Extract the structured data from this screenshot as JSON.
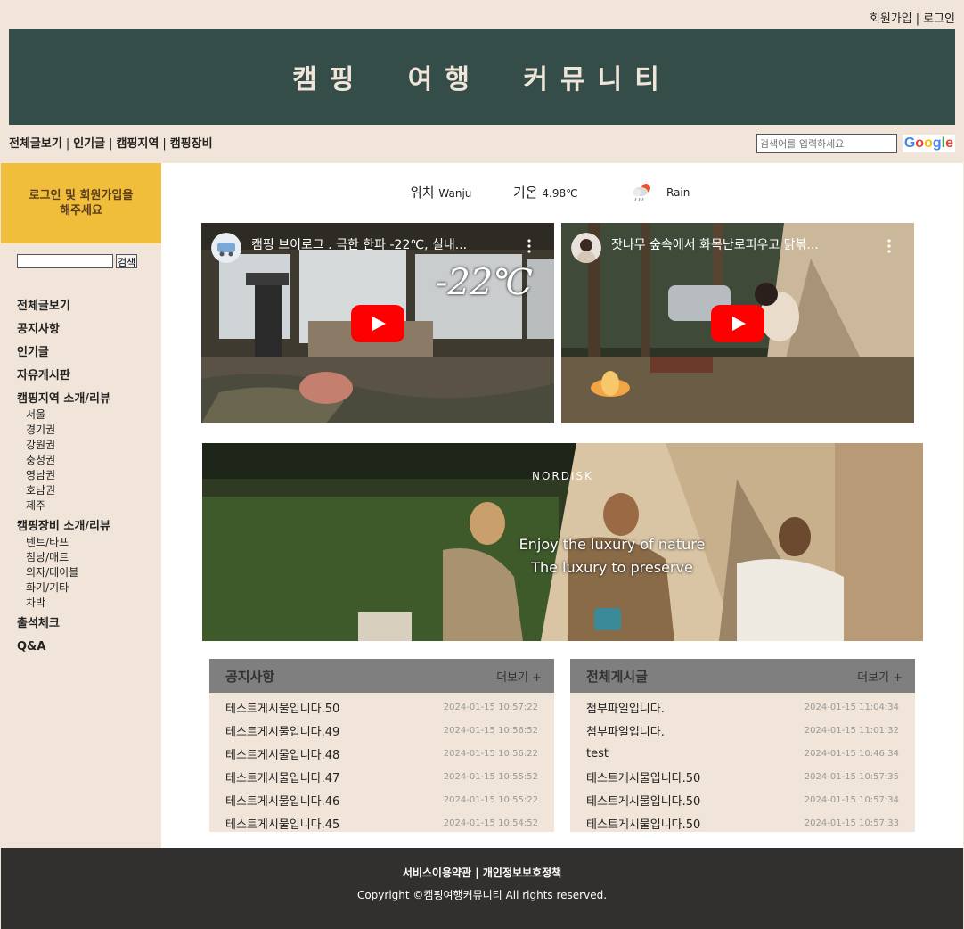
{
  "topbar": {
    "signup": "회원가입",
    "login": "로그인",
    "sep": "|"
  },
  "banner": {
    "title": "캠핑 여행 커뮤니티"
  },
  "mainnav": {
    "items": [
      "전체글보기",
      "인기글",
      "캠핑지역",
      "캠핑장비"
    ],
    "sep": "|"
  },
  "search": {
    "placeholder": "검색어를 입력하세요",
    "logo": [
      "G",
      "o",
      "o",
      "g",
      "l",
      "e"
    ]
  },
  "sidebar": {
    "login_msg_line1": "로그인 및 회원가입을",
    "login_msg_line2": "해주세요",
    "search_button": "검색",
    "menu": {
      "all": "전체글보기",
      "notice": "공지사항",
      "popular": "인기글",
      "free": "자유게시판",
      "region": "캠핑지역 소개/리뷰",
      "region_sub": [
        "서울",
        "경기권",
        "강원권",
        "충청권",
        "영남권",
        "호남권",
        "제주"
      ],
      "gear": "캠핑장비 소개/리뷰",
      "gear_sub": [
        "텐트/타프",
        "침낭/매트",
        "의자/테이블",
        "화기/기타",
        "차박"
      ],
      "attendance": "출석체크",
      "qna": "Q&A"
    }
  },
  "weather": {
    "location_label": "위치",
    "location_value": "Wanju",
    "temp_label": "기온",
    "temp_value": "4.98℃",
    "condition": "Rain",
    "icon": "rain-cloud-icon"
  },
  "videos": [
    {
      "title": "캠핑 브이로그 . 극한 한파 -22℃, 실내...",
      "overlay": "-22℃"
    },
    {
      "title": "잣나무 숲속에서 화목난로피우고 닭볶..."
    }
  ],
  "ad": {
    "brand": "NORDISK",
    "slogan1": "Enjoy the luxury of nature",
    "slogan2": "The luxury to preserve"
  },
  "boards": {
    "notice": {
      "title": "공지사항",
      "more": "더보기 +",
      "posts": [
        {
          "title": "테스트게시물입니다.50",
          "date": "2024-01-15 10:57:22"
        },
        {
          "title": "테스트게시물입니다.49",
          "date": "2024-01-15 10:56:52"
        },
        {
          "title": "테스트게시물입니다.48",
          "date": "2024-01-15 10:56:22"
        },
        {
          "title": "테스트게시물입니다.47",
          "date": "2024-01-15 10:55:52"
        },
        {
          "title": "테스트게시물입니다.46",
          "date": "2024-01-15 10:55:22"
        },
        {
          "title": "테스트게시물입니다.45",
          "date": "2024-01-15 10:54:52"
        }
      ]
    },
    "all": {
      "title": "전체게시글",
      "more": "더보기 +",
      "posts": [
        {
          "title": "첨부파일입니다.",
          "date": "2024-01-15 11:04:34"
        },
        {
          "title": "첨부파일입니다.",
          "date": "2024-01-15 11:01:32"
        },
        {
          "title": "test",
          "date": "2024-01-15 10:46:34"
        },
        {
          "title": "테스트게시물입니다.50",
          "date": "2024-01-15 10:57:35"
        },
        {
          "title": "테스트게시물입니다.50",
          "date": "2024-01-15 10:57:34"
        },
        {
          "title": "테스트게시물입니다.50",
          "date": "2024-01-15 10:57:33"
        }
      ]
    }
  },
  "footer": {
    "terms": "서비스이용약관",
    "sep": "|",
    "privacy": "개인정보보호정책",
    "copyright": "Copyright ©캠핑여행커뮤니티 All rights reserved."
  },
  "colors": {
    "bg": "#f0e5d8",
    "banner": "#344d48",
    "login_box": "#f1be3c",
    "board_head": "#7f7f7f",
    "footer": "#31302e",
    "yt_red": "#ff0000"
  }
}
